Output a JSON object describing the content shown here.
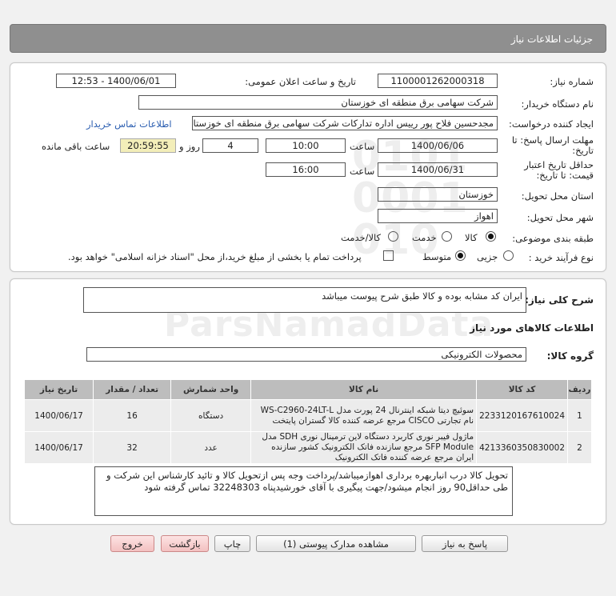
{
  "header": {
    "title": "جزئیات اطلاعات نیاز"
  },
  "form": {
    "need_number_label": "شماره نیاز:",
    "need_number": "1100001262000318",
    "announce_label": "تاریخ و ساعت اعلان عمومی:",
    "announce_value": "1400/06/01 - 12:53",
    "buyer_org_label": "نام دستگاه خریدار:",
    "buyer_org": "شرکت سهامی برق منطقه ای خوزستان",
    "creator_label": "ایجاد کننده درخواست:",
    "creator": "مجدحسین فلاح پور رییس اداره تدارکات شرکت سهامی برق منطقه ای خوزستان",
    "contact_link": "اطلاعات تماس خریدار",
    "deadline_label_1": "مهلت ارسال پاسخ: تا",
    "deadline_label_2": "تاریخ:",
    "deadline_date": "1400/06/06",
    "time_label": "ساعت",
    "deadline_time": "10:00",
    "days_value": "4",
    "days_label": "روز و",
    "remaining_time": "20:59:55",
    "remaining_label": "ساعت باقی مانده",
    "validity_label_1": "حداقل تاریخ اعتبار",
    "validity_label_2": "قیمت: تا تاریخ:",
    "validity_date": "1400/06/31",
    "validity_time_label": "ساعت",
    "validity_time": "16:00",
    "province_label": "استان محل تحویل:",
    "province": "خوزستان",
    "city_label": "شهر محل تحویل:",
    "city": "اهواز",
    "category_label": "طبقه بندی موضوعی:",
    "category_options": [
      "کالا",
      "خدمت",
      "کالا/خدمت"
    ],
    "category_selected": "کالا",
    "process_label": "نوع فرآیند خرید :",
    "process_options": [
      "جزیی",
      "متوسط"
    ],
    "process_selected": "متوسط",
    "payment_note": "پرداخت تمام یا بخشی از مبلغ خرید،از محل \"اسناد خزانه اسلامی\" خواهد بود."
  },
  "summary": {
    "label": "شرح کلی نیاز:",
    "text": "ایران کد مشابه بوده و کالا طبق شرح پیوست میباشد"
  },
  "goods": {
    "section_title": "اطلاعات کالاهای مورد نیاز",
    "group_label": "گروه کالا:",
    "group_value": "محصولات الکترونیکی",
    "columns": [
      "ردیف",
      "کد کالا",
      "نام کالا",
      "واحد شمارش",
      "تعداد / مقدار",
      "تاریخ نیاز"
    ],
    "rows": [
      {
        "row": "1",
        "code": "2233120167610024",
        "name": "سوئیچ دیتا شبکه اینترنال 24 پورت مدل WS-C2960-24LT-L نام تجارتی CISCO مرجع عرضه کننده کالا گستران پایتخت",
        "unit": "دستگاه",
        "qty": "16",
        "date": "1400/06/17"
      },
      {
        "row": "2",
        "code": "4213360350830002",
        "name": "ماژول فیبر نوری کاربرد دستگاه لاین ترمینال نوری SDH مدل SFP Module مرجع سازنده فاتک الکترونیک کشور سازنده ایران مرجع عرضه کننده فاتک الکترونیک",
        "unit": "عدد",
        "qty": "32",
        "date": "1400/06/17"
      }
    ]
  },
  "notes": {
    "text": "تحویل کالا درب انباربهره برداری اهوازمیباشد/پرداخت وجه پس ازتحویل کالا و تائید کارشناس این شرکت و طی حداقل90 روز انجام میشود/جهت پیگیری با آقای خورشیدپناه 32248303 تماس گرفته شود"
  },
  "buttons": {
    "reply": "پاسخ به نیاز",
    "attachments": "مشاهده مدارک پیوستی (1)",
    "print": "چاپ",
    "back": "بازگشت",
    "exit": "خروج"
  },
  "colors": {
    "header_bg": "#8f8f8f",
    "table_header_bg": "#bdbdbd",
    "remaining_bg": "#f3eeb9",
    "link": "#2a5db0",
    "danger_button": "#f3c1c1"
  }
}
